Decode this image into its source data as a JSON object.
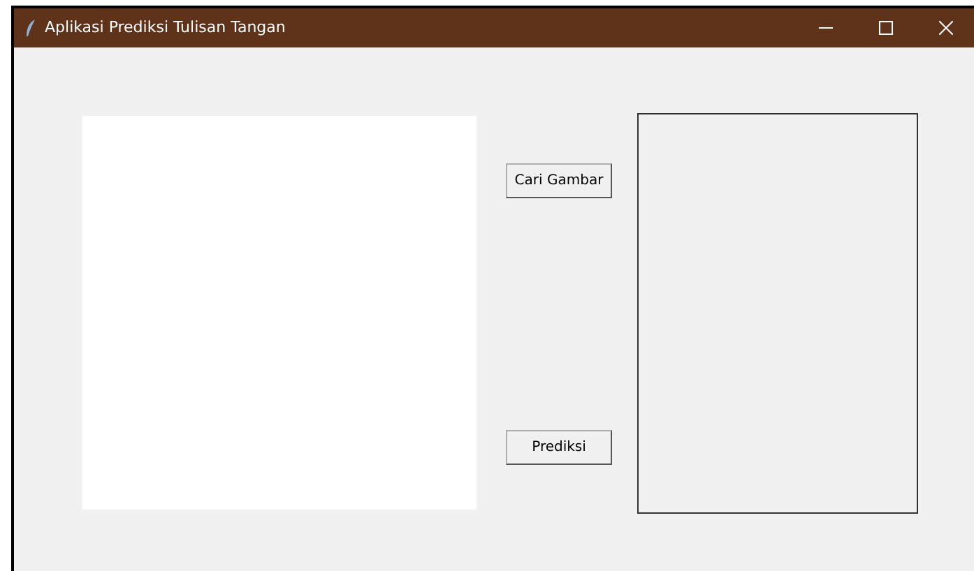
{
  "window": {
    "title": "Aplikasi Prediksi Tulisan Tangan"
  },
  "buttons": [
    {
      "label": "Cari Gambar"
    },
    {
      "label": "Prediksi"
    }
  ]
}
